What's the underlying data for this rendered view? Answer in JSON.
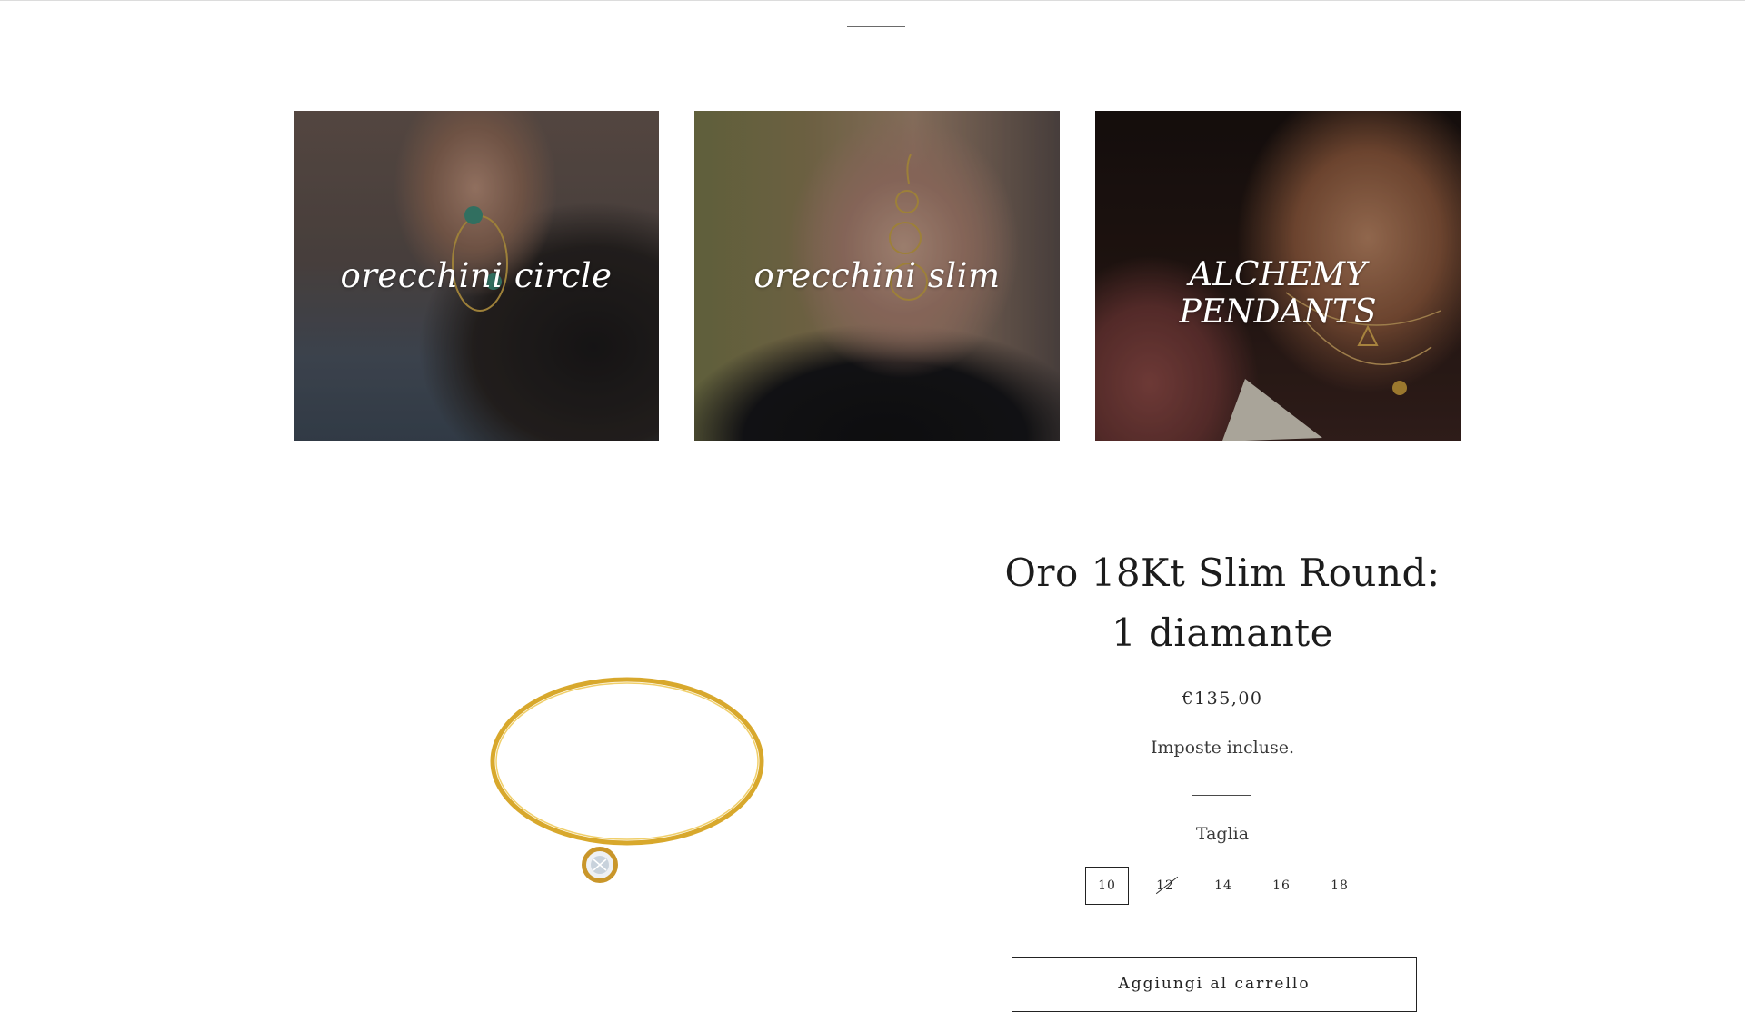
{
  "collections": [
    {
      "title": "orecchini circle"
    },
    {
      "title": "orecchini slim"
    },
    {
      "title": "ALCHEMY PENDANTS"
    }
  ],
  "product": {
    "title_line1": "Oro 18Kt Slim Round:",
    "title_line2": "1 diamante",
    "price": "€135,00",
    "tax_note": "Imposte incluse.",
    "size_label": "Taglia",
    "sizes": [
      {
        "label": "10",
        "selected": true,
        "available": true
      },
      {
        "label": "12",
        "selected": false,
        "available": false
      },
      {
        "label": "14",
        "selected": false,
        "available": true
      },
      {
        "label": "16",
        "selected": false,
        "available": true
      },
      {
        "label": "18",
        "selected": false,
        "available": true
      }
    ],
    "add_to_cart_label": "Aggiungi al carrello"
  },
  "colors": {
    "text": "#1c1c1c",
    "gold": "#d8a82c",
    "border": "#222222"
  },
  "icons": {
    "ring": "gold-ring-with-diamond"
  }
}
